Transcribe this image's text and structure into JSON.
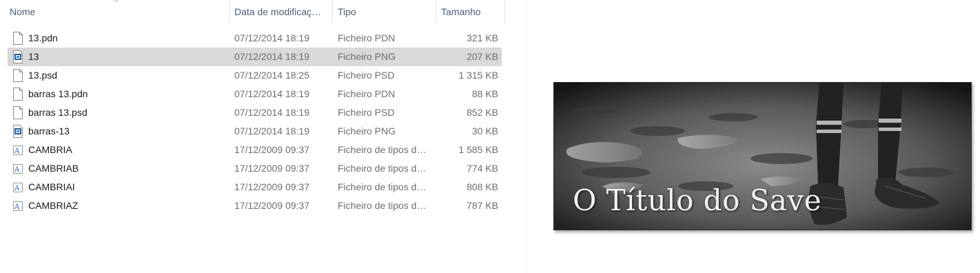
{
  "explorer": {
    "columns": {
      "name": "Nome",
      "date": "Data de modificaç…",
      "type": "Tipo",
      "size": "Tamanho"
    },
    "sort_indicator": "^",
    "files": [
      {
        "name": "13.pdn",
        "date": "07/12/2014 18:19",
        "type": "Ficheiro PDN",
        "size": "321 KB",
        "icon": "document-icon",
        "selected": false
      },
      {
        "name": "13",
        "date": "07/12/2014 18:19",
        "type": "Ficheiro PNG",
        "size": "207 KB",
        "icon": "image-file-icon",
        "selected": true
      },
      {
        "name": "13.psd",
        "date": "07/12/2014 18:25",
        "type": "Ficheiro PSD",
        "size": "1 315 KB",
        "icon": "document-icon",
        "selected": false
      },
      {
        "name": "barras 13.pdn",
        "date": "07/12/2014 18:19",
        "type": "Ficheiro PDN",
        "size": "88 KB",
        "icon": "document-icon",
        "selected": false
      },
      {
        "name": "barras 13.psd",
        "date": "07/12/2014 18:19",
        "type": "Ficheiro PSD",
        "size": "852 KB",
        "icon": "document-icon",
        "selected": false
      },
      {
        "name": "barras-13",
        "date": "07/12/2014 18:19",
        "type": "Ficheiro PNG",
        "size": "30 KB",
        "icon": "image-file-icon",
        "selected": false
      },
      {
        "name": "CAMBRIA",
        "date": "17/12/2009 09:37",
        "type": "Ficheiro de tipos d…",
        "size": "1 585 KB",
        "icon": "font-file-icon",
        "selected": false
      },
      {
        "name": "CAMBRIAB",
        "date": "17/12/2009 09:37",
        "type": "Ficheiro de tipos d…",
        "size": "774 KB",
        "icon": "font-file-icon",
        "selected": false
      },
      {
        "name": "CAMBRIAI",
        "date": "17/12/2009 09:37",
        "type": "Ficheiro de tipos d…",
        "size": "808 KB",
        "icon": "font-file-icon",
        "selected": false
      },
      {
        "name": "CAMBRIAZ",
        "date": "17/12/2009 09:37",
        "type": "Ficheiro de tipos d…",
        "size": "787 KB",
        "icon": "font-file-icon",
        "selected": false
      }
    ]
  },
  "preview": {
    "title": "O Título do Save"
  },
  "colors": {
    "header_text": "#4c5e7a",
    "selected_row": "#d9d9d9",
    "secondary_text": "#6d6d6d"
  }
}
